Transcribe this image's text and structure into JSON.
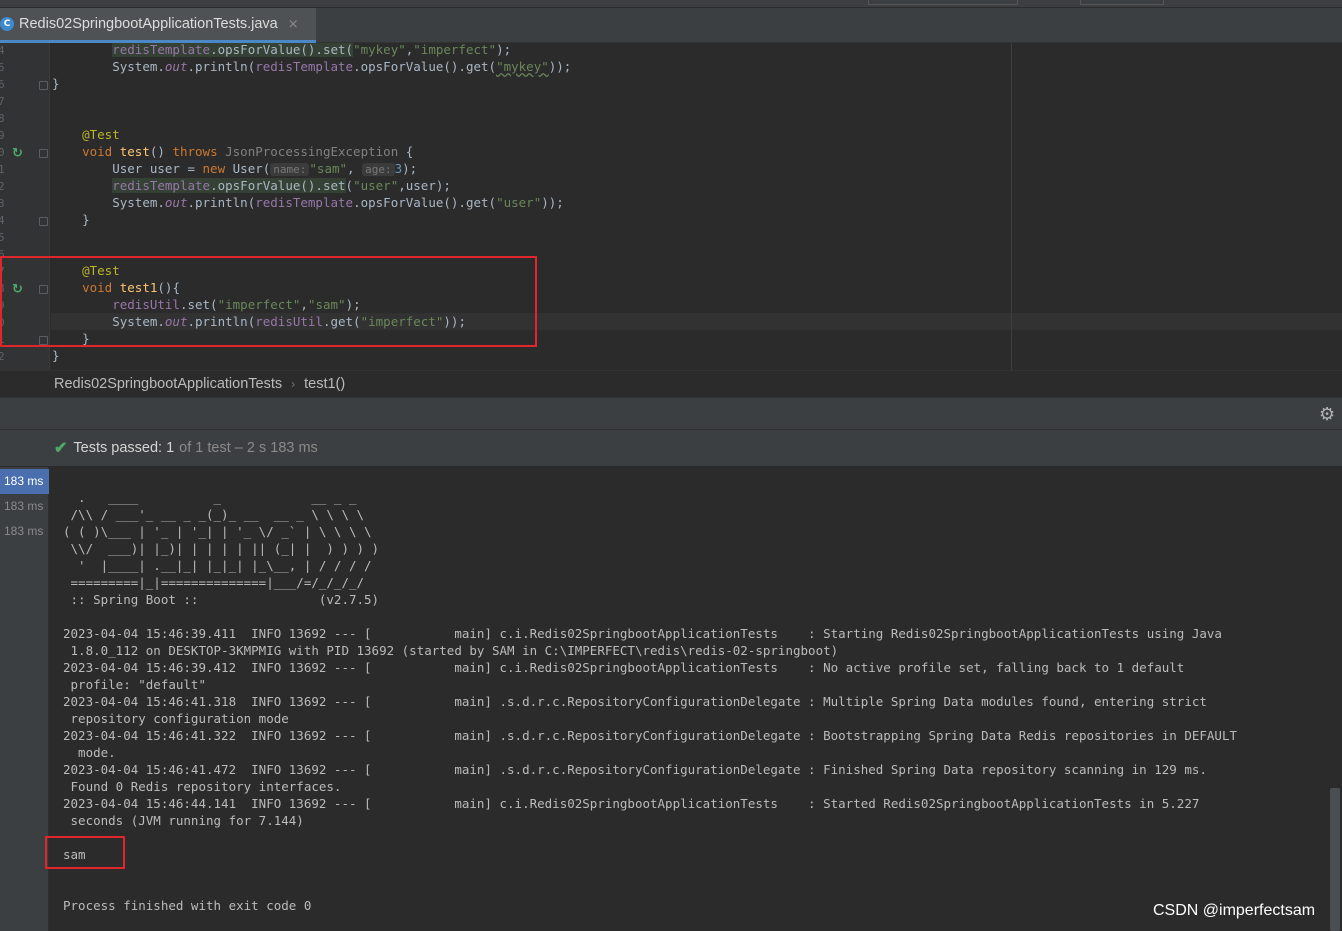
{
  "tab": {
    "filename": "Redis02SpringbootApplicationTests.java",
    "close_glyph": "×",
    "file_icon_letter": "C"
  },
  "gutter": {
    "line_numbers": [
      "4",
      "5",
      "6",
      "7",
      "8",
      "9",
      "0",
      "1",
      "2",
      "3",
      "4",
      "5",
      "6",
      "7",
      "8",
      "9",
      "0",
      "1",
      "2"
    ]
  },
  "code": {
    "l1": {
      "obj": "redisTemplate",
      "a": ".opsForValue().set(",
      "s1": "\"mykey\"",
      "c": ",",
      "s2": "\"imperfect\"",
      "end": ");"
    },
    "l2": {
      "a": "System.",
      "out": "out",
      "b": ".println(",
      "obj": "redisTemplate",
      "c": ".opsForValue().get(",
      "s": "\"mykey\"",
      "end": "));"
    },
    "l3": "}",
    "l4": "@Test",
    "l5": {
      "kw1": "void ",
      "fn": "test",
      "p": "() ",
      "kw2": "throws ",
      "ex": "JsonProcessingException",
      "b": " {"
    },
    "l6": {
      "a": "User user = ",
      "kw": "new ",
      "b": "User(",
      "h1": "name:",
      "s1": "\"sam\"",
      "c": ", ",
      "h2": "age:",
      "n": "3",
      "end": ");"
    },
    "l7": {
      "obj": "redisTemplate",
      "a": ".opsForValue().set",
      "b": "(",
      "s": "\"user\"",
      "c": ",user);"
    },
    "l8": {
      "a": "System.",
      "out": "out",
      "b": ".println(",
      "obj": "redisTemplate",
      "c": ".opsForValue().get(",
      "s": "\"user\"",
      "end": "));"
    },
    "l9": "}",
    "l10": "@Test",
    "l11": {
      "kw": "void ",
      "fn": "test1",
      "b": "(){"
    },
    "l12": {
      "obj": "redisUtil",
      "a": ".set(",
      "s1": "\"imperfect\"",
      "c": ",",
      "s2": "\"sam\"",
      "end": ");"
    },
    "l13": {
      "a": "System.",
      "out": "out",
      "b": ".println(",
      "obj": "redisUtil",
      "c": ".get(",
      "s": "\"imperfect\"",
      "end": "));"
    },
    "l14": "}",
    "l15": "}"
  },
  "breadcrumb": {
    "class": "Redis02SpringbootApplicationTests",
    "sep": "›",
    "method": "test1()"
  },
  "status": {
    "label": "Tests passed: ",
    "count": "1",
    "rest": "of 1 test – 2 s 183 ms"
  },
  "tests": {
    "durations": [
      "183 ms",
      "183 ms",
      "183 ms"
    ]
  },
  "console": {
    "banner": [
      "  .   ____          _            __ _ _",
      " /\\\\ / ___'_ __ _ _(_)_ __  __ _ \\ \\ \\ \\",
      "( ( )\\___ | '_ | '_| | '_ \\/ _` | \\ \\ \\ \\",
      " \\\\/  ___)| |_)| | | | | || (_| |  ) ) ) )",
      "  '  |____| .__|_| |_|_| |_\\__, | / / / /",
      " =========|_|==============|___/=/_/_/_/",
      " :: Spring Boot ::                (v2.7.5)"
    ],
    "log": [
      "2023-04-04 15:46:39.411  INFO 13692 --- [           main] c.i.Redis02SpringbootApplicationTests    : Starting Redis02SpringbootApplicationTests using Java",
      " 1.8.0_112 on DESKTOP-3KMPMIG with PID 13692 (started by SAM in C:\\IMPERFECT\\redis\\redis-02-springboot)",
      "2023-04-04 15:46:39.412  INFO 13692 --- [           main] c.i.Redis02SpringbootApplicationTests    : No active profile set, falling back to 1 default",
      " profile: \"default\"",
      "2023-04-04 15:46:41.318  INFO 13692 --- [           main] .s.d.r.c.RepositoryConfigurationDelegate : Multiple Spring Data modules found, entering strict",
      " repository configuration mode",
      "2023-04-04 15:46:41.322  INFO 13692 --- [           main] .s.d.r.c.RepositoryConfigurationDelegate : Bootstrapping Spring Data Redis repositories in DEFAULT",
      "  mode.",
      "2023-04-04 15:46:41.472  INFO 13692 --- [           main] .s.d.r.c.RepositoryConfigurationDelegate : Finished Spring Data repository scanning in 129 ms.",
      " Found 0 Redis repository interfaces.",
      "2023-04-04 15:46:44.141  INFO 13692 --- [           main] c.i.Redis02SpringbootApplicationTests    : Started Redis02SpringbootApplicationTests in 5.227",
      " seconds (JVM running for 7.144)"
    ],
    "output": "sam",
    "exit": "Process finished with exit code 0"
  },
  "watermark": "CSDN @imperfectsam",
  "colors": {
    "accent": "#4a88c7",
    "highlight_box": "#e0262b",
    "success": "#4eaa6b"
  }
}
